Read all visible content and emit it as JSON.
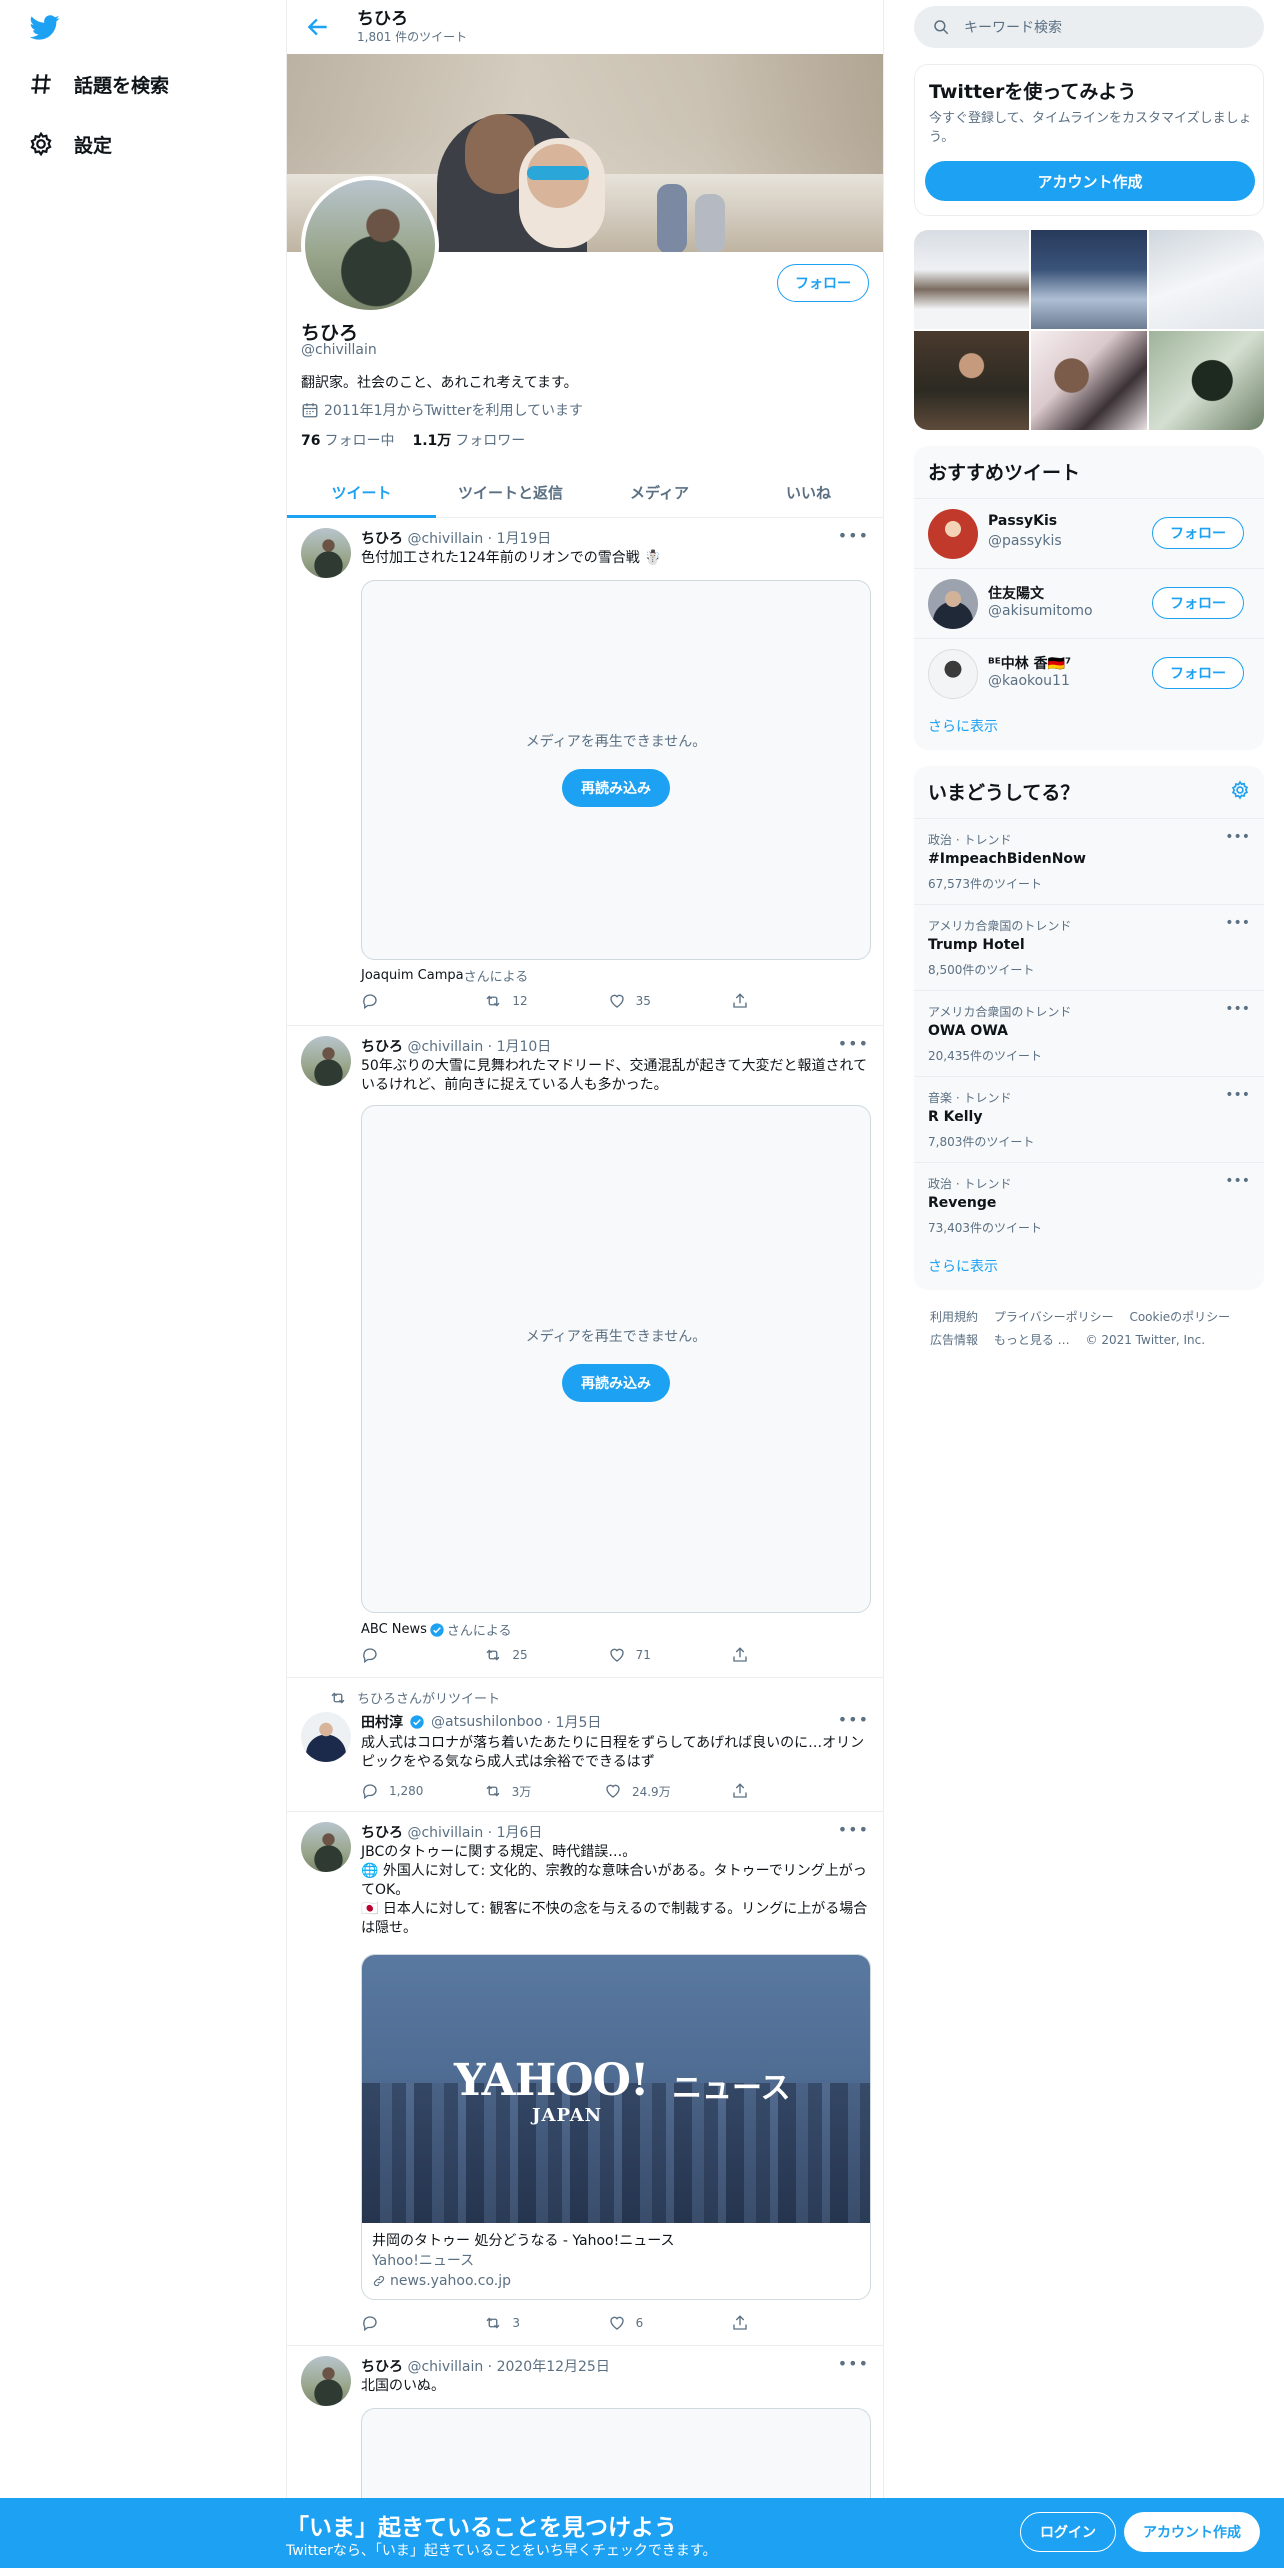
{
  "nav": {
    "logo": "twitter-bird-icon",
    "items": [
      {
        "label": "話題を検索",
        "icon": "hashtag-icon"
      },
      {
        "label": "設定",
        "icon": "gear-icon"
      }
    ]
  },
  "header": {
    "name": "ちひろ",
    "tweet_count": "1,801 件のツイート"
  },
  "profile": {
    "name": "ちひろ",
    "handle": "@chivillain",
    "bio": "翻訳家。社会のこと、あれこれ考えてます。",
    "joined": "2011年1月からTwitterを利用しています",
    "following_count": "76",
    "following_label": "フォロー中",
    "followers_count": "1.1万",
    "followers_label": "フォロワー",
    "follow_button": "フォロー"
  },
  "tabs": [
    "ツイート",
    "ツイートと返信",
    "メディア",
    "いいね"
  ],
  "tweets": [
    {
      "name": "ちひろ",
      "handle": "@chivillain",
      "date": "· 1月19日",
      "text": "色付加工された124年前のリオンでの雪合戦 ☃️",
      "media_message": "メディアを再生できません。",
      "reload": "再読み込み",
      "credit_name": "Joaquim Campa",
      "credit_suffix": "さんによる",
      "reply": "",
      "retweet": "12",
      "like": "35"
    },
    {
      "name": "ちひろ",
      "handle": "@chivillain",
      "date": "· 1月10日",
      "text": "50年ぶりの大雪に見舞われたマドリード、交通混乱が起きて大変だと報道されているけれど、前向きに捉えている人も多かった。",
      "media_message": "メディアを再生できません。",
      "reload": "再読み込み",
      "credit_name": "ABC News",
      "credit_suffix": "さんによる",
      "reply": "",
      "retweet": "25",
      "like": "71"
    },
    {
      "retweet_note": "ちひろさんがリツイート",
      "name": "田村淳",
      "handle": "@atsushilonboo",
      "date": "· 1月5日",
      "text": "成人式はコロナが落ち着いたあたりに日程をずらしてあげれば良いのに…オリンピックをやる気なら成人式は余裕でできるはず",
      "reply": "1,280",
      "retweet": "3万",
      "like": "24.9万"
    },
    {
      "name": "ちひろ",
      "handle": "@chivillain",
      "date": "· 1月6日",
      "text_lines": [
        "JBCのタトゥーに関する規定、時代錯誤…。",
        "🌐 外国人に対して: 文化的、宗教的な意味合いがある。タトゥーでリング上がってOK。",
        "🇯🇵 日本人に対して: 観客に不快の念を与えるので制裁する。リングに上がる場合は隠せ。"
      ],
      "card": {
        "logo": "YAHOO!",
        "logo_sub": "JAPAN",
        "logo_news": "ニュース",
        "title": "井岡のタトゥー 処分どうなる - Yahoo!ニュース",
        "site": "Yahoo!ニュース",
        "url": "news.yahoo.co.jp"
      },
      "reply": "",
      "retweet": "3",
      "like": "6"
    },
    {
      "name": "ちひろ",
      "handle": "@chivillain",
      "date": "· 2020年12月25日",
      "text": "北国のいぬ。"
    }
  ],
  "right": {
    "search_placeholder": "キーワード検索",
    "signup_title": "Twitterを使ってみよう",
    "signup_desc": "今すぐ登録して、タイムラインをカスタマイズしましょう。",
    "signup_button": "アカウント作成",
    "recommend_title": "おすすめツイート",
    "recommend": [
      {
        "name": "PassyKis",
        "handle": "@passykis",
        "button": "フォロー",
        "avatar_color": "#c0392b"
      },
      {
        "name": "住友陽文",
        "handle": "@akisumitomo",
        "button": "フォロー",
        "avatar_color": "#4b5563"
      },
      {
        "name": "ᴮᴱ中林 香🇩🇪⁷",
        "handle": "@kaokou11",
        "button": "フォロー",
        "avatar_color": "#e5e7eb"
      }
    ],
    "recommend_more": "さらに表示",
    "trends_title": "いまどうしてる？",
    "trends": [
      {
        "context": "政治 · トレンド",
        "title": "#ImpeachBidenNow",
        "count": "67,573件のツイート"
      },
      {
        "context": "アメリカ合衆国のトレンド",
        "title": "Trump Hotel",
        "count": "8,500件のツイート"
      },
      {
        "context": "アメリカ合衆国のトレンド",
        "title": "OWA OWA",
        "count": "20,435件のツイート"
      },
      {
        "context": "音楽 · トレンド",
        "title": "R Kelly",
        "count": "7,803件のツイート"
      },
      {
        "context": "政治 · トレンド",
        "title": "Revenge",
        "count": "73,403件のツイート"
      }
    ],
    "trends_more": "さらに表示",
    "footer": [
      "利用規約",
      "プライバシーポリシー",
      "Cookieのポリシー",
      "広告情報",
      "もっと見る …",
      "© 2021 Twitter, Inc."
    ]
  },
  "bottom": {
    "title": "「いま」起きていることを見つけよう",
    "subtitle": "Twitterなら、「いま」起きていることをいち早くチェックできます。",
    "login": "ログイン",
    "signup": "アカウント作成"
  },
  "colors": {
    "accent": "#1da1f2",
    "text": "#0f1419",
    "muted": "#5b7083"
  }
}
